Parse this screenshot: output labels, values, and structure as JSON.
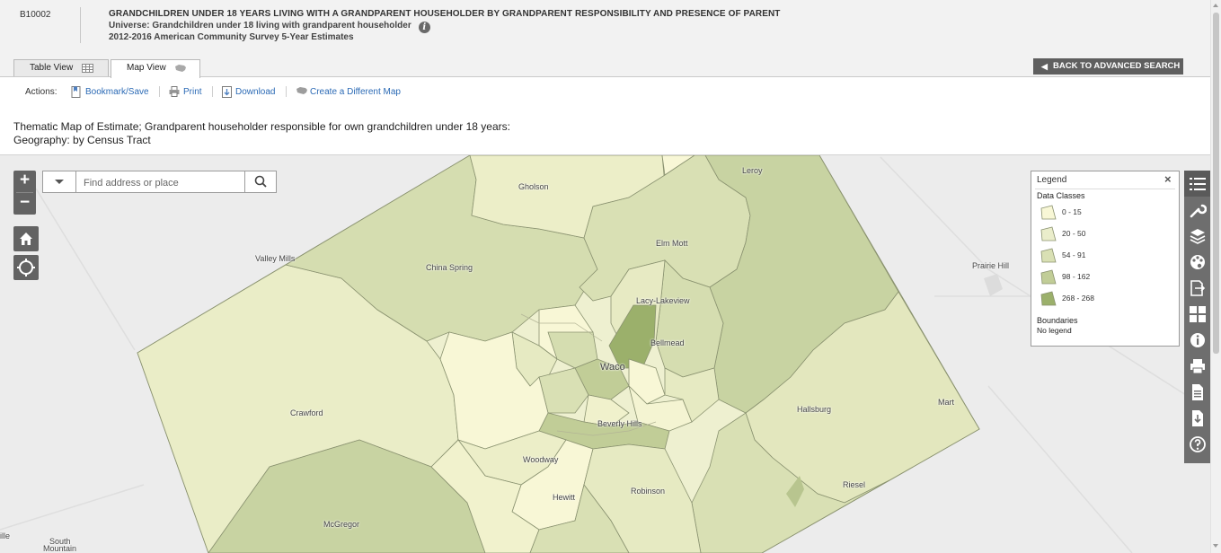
{
  "header": {
    "table_id": "B10002",
    "title": "GRANDCHILDREN UNDER 18 YEARS LIVING WITH A GRANDPARENT HOUSEHOLDER BY GRANDPARENT RESPONSIBILITY AND PRESENCE OF PARENT",
    "universe": "Universe: Grandchildren under 18 living with grandparent householder",
    "survey": "2012-2016 American Community Survey 5-Year Estimates",
    "info_icon": "info-icon"
  },
  "tabs": [
    {
      "label": "Table View",
      "icon": "table-icon",
      "active": false
    },
    {
      "label": "Map View",
      "icon": "map-icon",
      "active": true
    }
  ],
  "back_button": "BACK TO ADVANCED SEARCH",
  "actions": {
    "label": "Actions:",
    "items": [
      {
        "label": "Bookmark/Save",
        "icon": "bookmark-icon"
      },
      {
        "label": "Print",
        "icon": "print-icon"
      },
      {
        "label": "Download",
        "icon": "download-icon"
      },
      {
        "label": "Create a Different Map",
        "icon": "map-icon"
      }
    ]
  },
  "map_title": {
    "line1": "Thematic Map of Estimate; Grandparent householder responsible for own grandchildren under 18 years:",
    "line2": "Geography: by Census Tract"
  },
  "search": {
    "placeholder": "Find address or place"
  },
  "zoom": {
    "in": "+",
    "out": "−"
  },
  "legend": {
    "title": "Legend",
    "close": "×",
    "data_classes_label": "Data Classes",
    "classes": [
      {
        "range": "0 - 15",
        "color": "#f8f7d6"
      },
      {
        "range": "20 - 50",
        "color": "#eaedcb"
      },
      {
        "range": "54 - 91",
        "color": "#d9e0b4"
      },
      {
        "range": "98 - 162",
        "color": "#c1cd97"
      },
      {
        "range": "268 - 268",
        "color": "#9bb06b"
      }
    ],
    "boundaries_label": "Boundaries",
    "boundaries_value": "No legend"
  },
  "places": [
    {
      "name": "Gholson"
    },
    {
      "name": "Leroy"
    },
    {
      "name": "Elm Mott"
    },
    {
      "name": "Valley Mills"
    },
    {
      "name": "China Spring"
    },
    {
      "name": "Prairie Hill"
    },
    {
      "name": "Lacy-Lakeview"
    },
    {
      "name": "Bellmead"
    },
    {
      "name": "Waco"
    },
    {
      "name": "Crawford"
    },
    {
      "name": "Hallsburg"
    },
    {
      "name": "Mart"
    },
    {
      "name": "Beverly Hills"
    },
    {
      "name": "Woodway"
    },
    {
      "name": "Robinson"
    },
    {
      "name": "Hewitt"
    },
    {
      "name": "Riesel"
    },
    {
      "name": "McGregor"
    },
    {
      "name": "South"
    },
    {
      "name": "Mountain"
    },
    {
      "name": "ille"
    }
  ],
  "toolbar": [
    "legend-list-icon",
    "wrench-icon",
    "layers-icon",
    "palette-icon",
    "export-icon",
    "grid-icon",
    "info-icon",
    "print-icon",
    "document-icon",
    "download-icon",
    "help-icon"
  ]
}
